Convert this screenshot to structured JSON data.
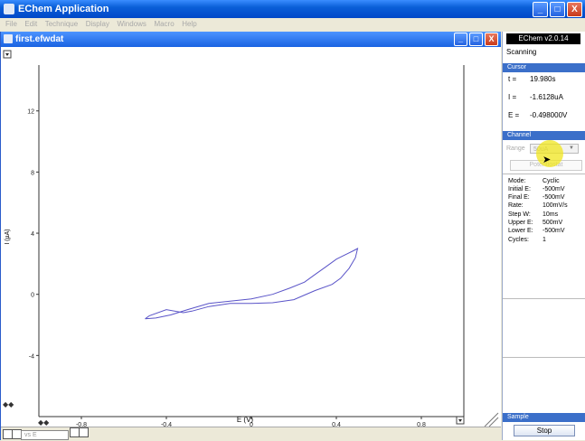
{
  "app": {
    "title": "EChem Application"
  },
  "menu": [
    "File",
    "Edit",
    "Technique",
    "Display",
    "Windows",
    "Macro",
    "Help"
  ],
  "window_buttons": {
    "minimize": "_",
    "maximize": "□",
    "close": "X"
  },
  "document": {
    "title": "first.efwdat"
  },
  "plot": {
    "x_ticks": [
      "-0.8",
      "-0.4",
      "0",
      "0.4",
      "0.8"
    ],
    "y_ticks": [
      "12",
      "8",
      "4",
      "0",
      "-4"
    ],
    "xlabel": "E (V)",
    "ylabel": "I (µA)",
    "line_color": "#5a54c8"
  },
  "chart_data": {
    "type": "line",
    "xlabel": "E (V)",
    "ylabel": "I (µA)",
    "xlim": [
      -1.0,
      1.0
    ],
    "ylim": [
      -8,
      15
    ],
    "series": [
      {
        "x": [
          -0.5,
          -0.45,
          -0.38,
          -0.3,
          -0.2,
          -0.1,
          0.0,
          0.1,
          0.18,
          0.25,
          0.3,
          0.35,
          0.4,
          0.45,
          0.48,
          0.5,
          0.49,
          0.46,
          0.42,
          0.38,
          0.3,
          0.25,
          0.2,
          0.1,
          0.0,
          -0.1,
          -0.2,
          -0.28,
          -0.32,
          -0.4,
          -0.48,
          -0.5
        ],
        "y": [
          -1.6,
          -1.55,
          -1.35,
          -1.0,
          -0.6,
          -0.45,
          -0.3,
          0.0,
          0.4,
          0.8,
          1.3,
          1.8,
          2.3,
          2.65,
          2.85,
          3.0,
          2.4,
          1.7,
          1.05,
          0.65,
          0.25,
          -0.05,
          -0.35,
          -0.55,
          -0.6,
          -0.6,
          -0.8,
          -1.1,
          -1.2,
          -1.0,
          -1.4,
          -1.6
        ]
      }
    ]
  },
  "panel": {
    "version": "EChem v2.0.14",
    "status": "Scanning",
    "cursor_header": "Cursor",
    "cursor": [
      {
        "label": "t =",
        "value": "19.980s"
      },
      {
        "label": "I =",
        "value": "-1.6128uA"
      },
      {
        "label": "E =",
        "value": "-0.498000V"
      }
    ],
    "channel_header": "Channel",
    "range_label": "Range",
    "range_value": "50uA",
    "potentiostat_label": "Potentiostat",
    "params": [
      {
        "label": "Mode:",
        "value": "Cyclic"
      },
      {
        "label": "Initial E:",
        "value": "-500mV"
      },
      {
        "label": "Final E:",
        "value": "-500mV"
      },
      {
        "label": "Rate:",
        "value": "100mV/s"
      },
      {
        "label": "Step W:",
        "value": "10ms"
      },
      {
        "label": "Upper E:",
        "value": "500mV"
      },
      {
        "label": "Lower E:",
        "value": "-500mV"
      },
      {
        "label": "Cycles:",
        "value": "1"
      }
    ],
    "sample_header": "Sample",
    "stop_label": "Stop"
  },
  "statusbar": {
    "combo_value": "vs E"
  }
}
